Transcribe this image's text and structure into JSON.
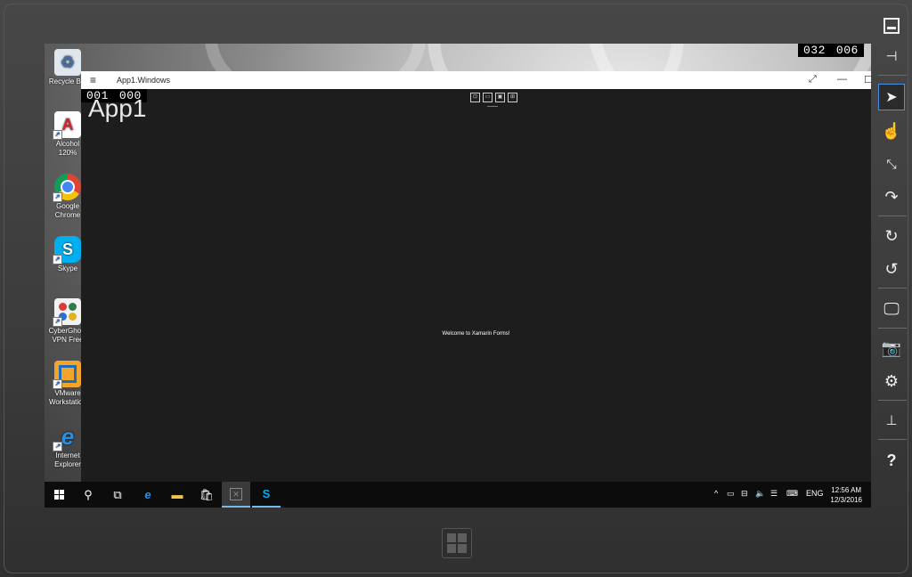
{
  "desktop": {
    "icons": [
      {
        "label": "Recycle Bin",
        "icon": "recycle-bin-icon",
        "color": "#9bb7d4"
      },
      {
        "label": "Alcohol 120%",
        "icon": "alcohol-icon",
        "color": "#d6242b"
      },
      {
        "label": "Google Chrome",
        "icon": "chrome-icon",
        "color": "#e8453c"
      },
      {
        "label": "Skype",
        "icon": "skype-icon",
        "color": "#00aff0"
      },
      {
        "label": "CyberGhost VPN Free",
        "icon": "cyberghost-icon",
        "color": "#2d7d46"
      },
      {
        "label": "VMware Workstation",
        "icon": "vmware-icon",
        "color": "#f3a42c"
      },
      {
        "label": "Internet Explorer",
        "icon": "internet-explorer-icon",
        "color": "#2a8ee0"
      }
    ]
  },
  "counters": {
    "top_left": [
      "001",
      "000"
    ],
    "top_right": [
      "032",
      "006"
    ]
  },
  "app_window": {
    "title": "App1.Windows",
    "header": "App1",
    "welcome_text": "Welcome to Xamarin Forms!"
  },
  "taskbar": {
    "tray_language": "ENG",
    "time": "12:56 AM",
    "date": "12/3/2016"
  },
  "emulator_toolbar": [
    "minimize-icon",
    "pin-icon",
    "pointer-icon",
    "touch-icon",
    "pinch-zoom-icon",
    "rotate-gesture-icon",
    "rotate-clockwise-icon",
    "rotate-counterclockwise-icon",
    "screen-resolution-icon",
    "screenshot-icon",
    "settings-icon",
    "network-icon",
    "help-icon"
  ],
  "colors": {
    "accent": "#4a90e2",
    "app_background": "#1d1d1d",
    "taskbar": "#0c0c0c"
  }
}
